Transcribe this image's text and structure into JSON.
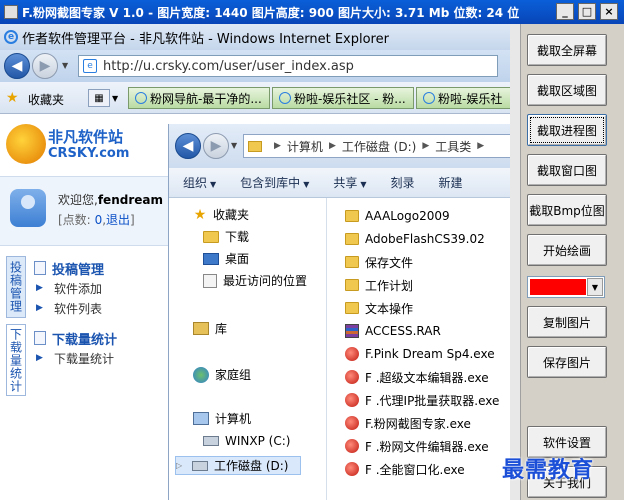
{
  "app": {
    "title": "F.粉网截图专家 V 1.0 - 图片宽度: 1440 图片高度: 900 图片大小: 3.71 Mb 位数: 24 位",
    "min": "_",
    "max": "□",
    "close": "×"
  },
  "ie": {
    "title": "作者软件管理平台 - 非凡软件站 - Windows Internet Explorer",
    "url": "http://u.crsky.com/user/user_index.asp",
    "favorites_label": "收藏夹",
    "fav_tabs": [
      "粉网导航-最干净的...",
      "粉啦-娱乐社区 - 粉...",
      "粉啦-娱乐社"
    ]
  },
  "site": {
    "logo_name": "非凡软件站",
    "logo_domain": "CRSKY.com",
    "welcome_prefix": "欢迎您,",
    "username": "fendream",
    "points_prefix": "[点数:",
    "points_value": "0",
    "points_sep": ",",
    "logout": "退出",
    "points_suffix": "]",
    "vtab1": "投稿管理",
    "vtab2": "下载量统计",
    "sections": [
      {
        "title": "投稿管理",
        "items": [
          "软件添加",
          "软件列表"
        ]
      },
      {
        "title": "下载量统计",
        "items": [
          "下载量统计"
        ]
      }
    ]
  },
  "explorer": {
    "path": [
      "计算机",
      "工作磁盘 (D:)",
      "工具类"
    ],
    "toolbar": [
      {
        "label": "组织",
        "dropdown": true
      },
      {
        "label": "包含到库中",
        "dropdown": true
      },
      {
        "label": "共享",
        "dropdown": true
      },
      {
        "label": "刻录",
        "dropdown": false
      },
      {
        "label": "新建",
        "dropdown": false
      }
    ],
    "nav": {
      "favorites": "收藏夹",
      "downloads": "下载",
      "desktop": "桌面",
      "recent": "最近访问的位置",
      "library": "库",
      "homegroup": "家庭组",
      "computer": "计算机",
      "drive_c": "WINXP (C:)",
      "drive_d": "工作磁盘 (D:)"
    },
    "files": [
      {
        "name": "AAALogo2009",
        "type": "folder"
      },
      {
        "name": "AdobeFlashCS39.02",
        "type": "folder"
      },
      {
        "name": "保存文件",
        "type": "folder"
      },
      {
        "name": "工作计划",
        "type": "folder"
      },
      {
        "name": "文本操作",
        "type": "folder"
      },
      {
        "name": "ACCESS.RAR",
        "type": "rar"
      },
      {
        "name": "F.Pink Dream Sp4.exe",
        "type": "exe"
      },
      {
        "name": "F .超级文本编辑器.exe",
        "type": "exe"
      },
      {
        "name": "F .代理IP批量获取器.exe",
        "type": "exe"
      },
      {
        "name": "F.粉网截图专家.exe",
        "type": "exe"
      },
      {
        "name": "F .粉网文件编辑器.exe",
        "type": "exe"
      },
      {
        "name": "F .全能窗口化.exe",
        "type": "exe"
      }
    ]
  },
  "panel": {
    "capture_full": "截取全屏幕",
    "capture_region": "截取区域图",
    "capture_process": "截取进程图",
    "capture_window": "截取窗口图",
    "capture_bmp": "截取Bmp位图",
    "start_draw": "开始绘画",
    "pen_color": "#ff0000",
    "copy_image": "复制图片",
    "save_image": "保存图片",
    "settings": "软件设置",
    "about": "关于我们"
  },
  "watermark": "最需教育"
}
